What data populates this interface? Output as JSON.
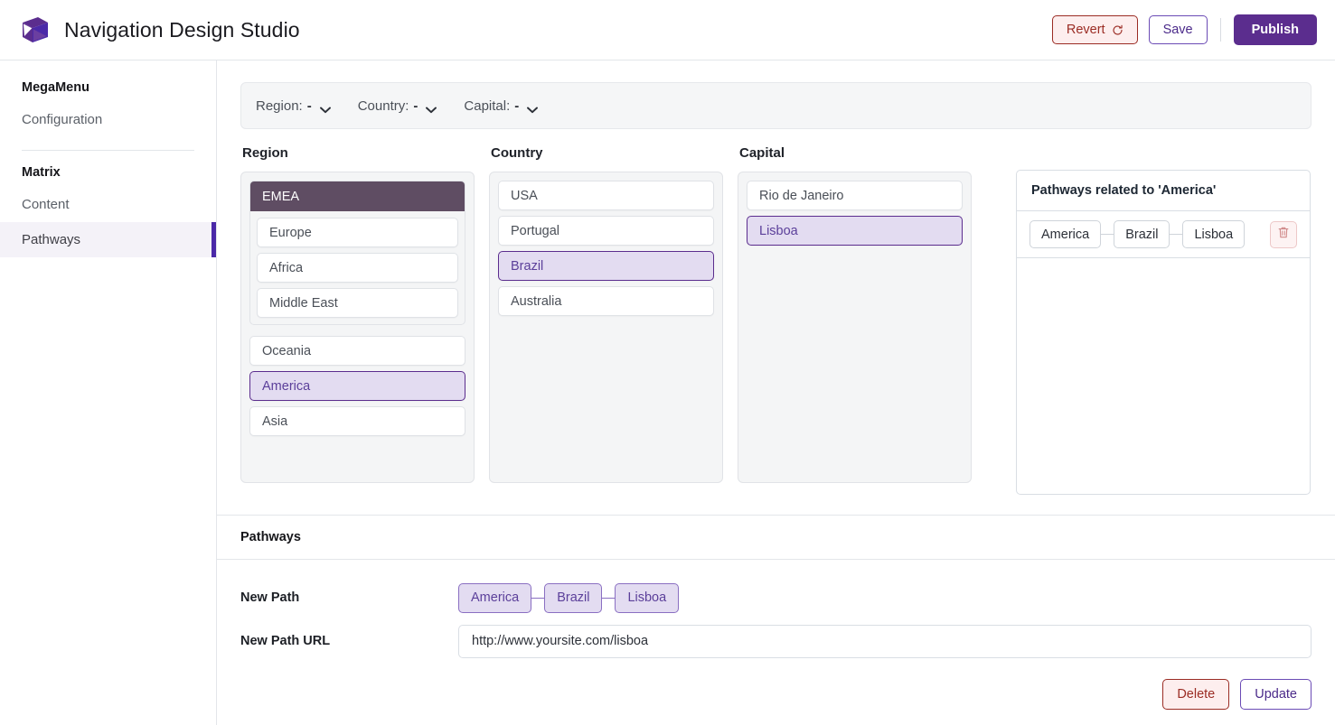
{
  "app": {
    "title": "Navigation Design Studio",
    "logo_icon": "cube-logo-icon"
  },
  "topbar": {
    "revert_label": "Revert",
    "revert_icon": "refresh-icon",
    "save_label": "Save",
    "publish_label": "Publish"
  },
  "sidebar": {
    "groups": [
      {
        "title": "MegaMenu",
        "items": [
          {
            "label": "Configuration",
            "active": false
          }
        ]
      },
      {
        "title": "Matrix",
        "items": [
          {
            "label": "Content",
            "active": false
          },
          {
            "label": "Pathways",
            "active": true
          }
        ]
      }
    ]
  },
  "filters": [
    {
      "label": "Region:",
      "value": "-",
      "icon": "chevron-down-icon"
    },
    {
      "label": "Country:",
      "value": "-",
      "icon": "chevron-down-icon"
    },
    {
      "label": "Capital:",
      "value": "-",
      "icon": "chevron-down-icon"
    }
  ],
  "matrix": {
    "columns": [
      {
        "title": "Region",
        "nodes": [
          {
            "type": "group",
            "label": "EMEA",
            "children": [
              {
                "label": "Europe",
                "selected": false
              },
              {
                "label": "Africa",
                "selected": false
              },
              {
                "label": "Middle East",
                "selected": false
              }
            ]
          },
          {
            "type": "item",
            "label": "Oceania",
            "selected": false
          },
          {
            "type": "item",
            "label": "America",
            "selected": true
          },
          {
            "type": "item",
            "label": "Asia",
            "selected": false
          }
        ]
      },
      {
        "title": "Country",
        "nodes": [
          {
            "type": "item",
            "label": "USA",
            "selected": false
          },
          {
            "type": "item",
            "label": "Portugal",
            "selected": false
          },
          {
            "type": "item",
            "label": "Brazil",
            "selected": true
          },
          {
            "type": "item",
            "label": "Australia",
            "selected": false
          }
        ]
      },
      {
        "title": "Capital",
        "nodes": [
          {
            "type": "item",
            "label": "Rio de Janeiro",
            "selected": false
          },
          {
            "type": "item",
            "label": "Lisboa",
            "selected": true
          }
        ]
      }
    ]
  },
  "related": {
    "header": "Pathways related to 'America'",
    "rows": [
      {
        "chips": [
          "America",
          "Brazil",
          "Lisboa"
        ],
        "delete_icon": "trash-icon"
      }
    ]
  },
  "pathways_section": {
    "title": "Pathways",
    "new_path_label": "New Path",
    "new_path_chips": [
      "America",
      "Brazil",
      "Lisboa"
    ],
    "new_path_url_label": "New Path URL",
    "new_path_url_value": "http://www.yoursite.com/lisboa",
    "new_path_url_placeholder": "http://www.yoursite.com/lisboa",
    "delete_label": "Delete",
    "update_label": "Update"
  },
  "colors": {
    "brand_purple": "#5b2d8e",
    "active_indicator": "#4b29a8",
    "group_header": "#5f4d63",
    "selection_bg": "#e3dcf1",
    "danger": "#9b2c24"
  }
}
